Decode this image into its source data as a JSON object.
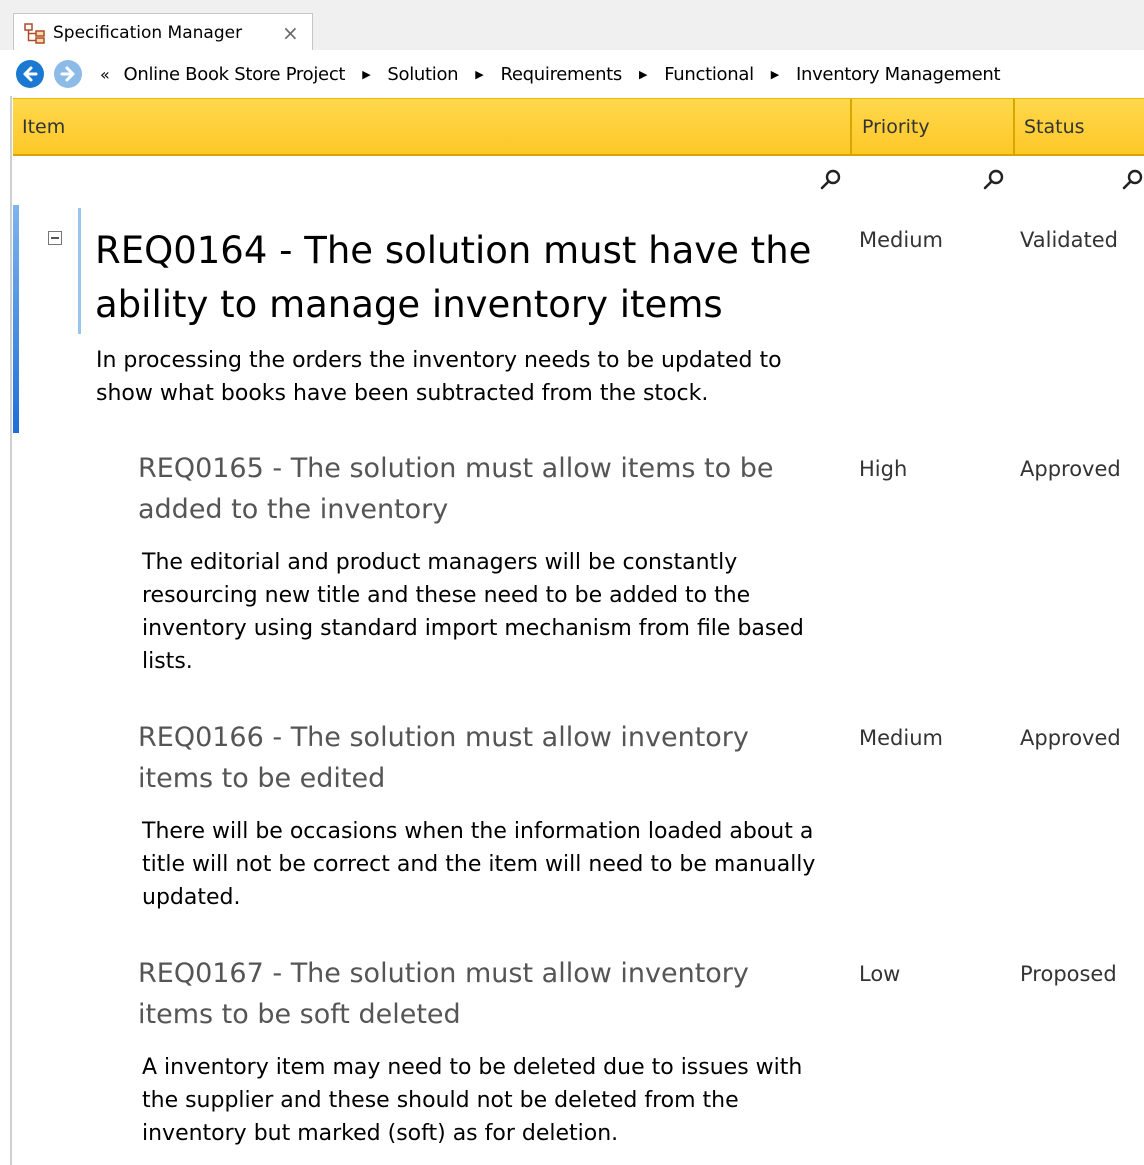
{
  "tab": {
    "title": "Specification Manager",
    "close": "×"
  },
  "breadcrumb": {
    "overflow": "«",
    "items": [
      "Online Book Store Project",
      "Solution",
      "Requirements",
      "Functional",
      "Inventory Management"
    ],
    "separator": "▶"
  },
  "columns": {
    "item": "Item",
    "priority": "Priority",
    "status": "Status"
  },
  "requirements": [
    {
      "title": "REQ0164 - The solution must have the ability to manage inventory items",
      "description": "In processing the orders the inventory needs to be updated to show what books have been subtracted from the stock.",
      "priority": "Medium",
      "status": "Validated"
    },
    {
      "title": "REQ0165 - The solution must allow items to be added to the inventory",
      "description": "The editorial and product managers will be constantly resourcing new title and these need to be added to the inventory using standard import mechanism from file based lists.",
      "priority": "High",
      "status": "Approved"
    },
    {
      "title": "REQ0166 - The solution must allow inventory items to be edited",
      "description": "There will be occasions when the information loaded about a title will not be correct and the item will need to be manually updated.",
      "priority": "Medium",
      "status": "Approved"
    },
    {
      "title": "REQ0167 - The solution must allow inventory items to be soft deleted",
      "description": "A inventory item may need to be deleted due to issues with the supplier and these should not be deleted from the inventory but marked (soft) as for deletion.",
      "priority": "Low",
      "status": "Proposed"
    }
  ],
  "colors": {
    "header": "#fdc828",
    "selection": "#1e6fd8",
    "nav_back": "#1b79d2",
    "nav_forward": "#8cbbe8"
  }
}
